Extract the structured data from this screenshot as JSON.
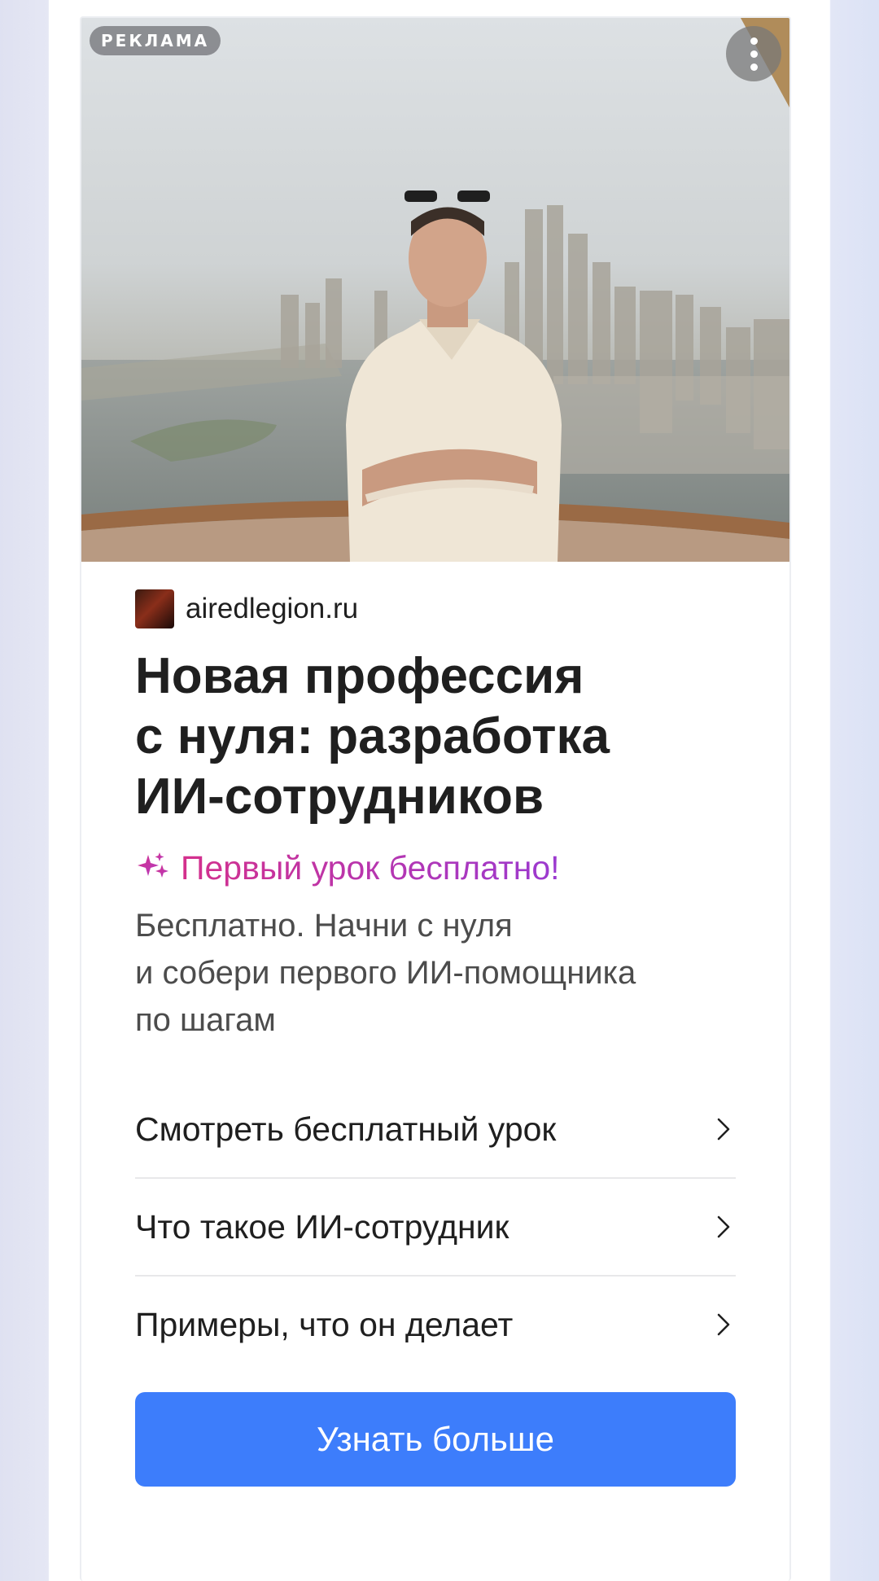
{
  "ad": {
    "badge": "РЕКЛАМА",
    "source": "airedlegion.ru",
    "headline_lines": [
      "Новая профессия",
      "с нуля: разработка",
      "ИИ-сотрудников"
    ],
    "promo": "Первый урок бесплатно!",
    "promo_icon": "sparkles-icon",
    "description_lines": [
      "Бесплатно. Начни с нуля",
      "и собери первого ИИ-помощника",
      "по шагам"
    ],
    "links": [
      {
        "label": "Смотреть бесплатный урок",
        "icon": "chevron-right-icon"
      },
      {
        "label": "Что такое ИИ-сотрудник",
        "icon": "chevron-right-icon"
      },
      {
        "label": "Примеры, что он делает",
        "icon": "chevron-right-icon"
      }
    ],
    "cta": "Узнать больше"
  },
  "colors": {
    "cta": "#3d7dfb",
    "promo_gradient_start": "#d4308c",
    "promo_gradient_end": "#9b3ad0",
    "headline": "#1f1f1f",
    "description": "#4c4c4c"
  }
}
